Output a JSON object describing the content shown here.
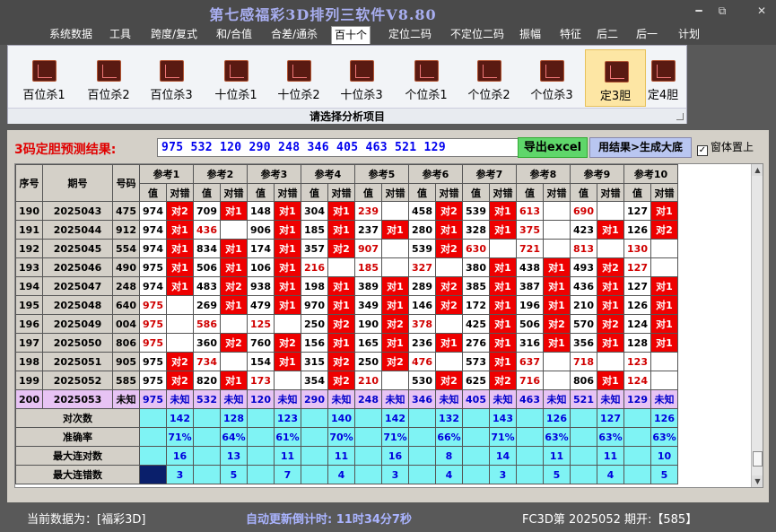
{
  "app": {
    "title": "第七感福彩3D排列三软件V8.80"
  },
  "window_buttons": {
    "minimize": "━",
    "restore": "⧉",
    "close": "✕"
  },
  "menu": [
    "系统数据",
    "工具",
    "跨度/复式",
    "和/合值",
    "合差/通杀",
    "百十个",
    "定位二码",
    "不定位二码",
    "振幅",
    "特征",
    "后二",
    "后一",
    "计划"
  ],
  "menu_active": "百十个",
  "ribbon": {
    "buttons": [
      "百位杀1",
      "百位杀2",
      "百位杀3",
      "十位杀1",
      "十位杀2",
      "十位杀3",
      "个位杀1",
      "个位杀2",
      "个位杀3",
      "定3胆",
      "定4胆"
    ],
    "active": "定3胆",
    "footer": "请选择分析项目"
  },
  "result": {
    "label": "3码定胆预测结果:",
    "value": "975 532 120 290 248 346 405 463 521 129",
    "export_button": "导出excel",
    "big_button": "用结果>生成大底",
    "on_top_label": "窗体置上",
    "on_top_checked": "✓"
  },
  "table": {
    "header": {
      "seq": "序号",
      "period": "期号",
      "code": "号码",
      "value": "值",
      "check": "对错"
    },
    "refs": [
      "参考1",
      "参考2",
      "参考3",
      "参考4",
      "参考5",
      "参考6",
      "参考7",
      "参考8",
      "参考9",
      "参考10"
    ],
    "rows": [
      {
        "seq": "190",
        "period": "2025043",
        "code": "475",
        "cells": [
          [
            "974",
            "对2"
          ],
          [
            "709",
            "对1"
          ],
          [
            "148",
            "对1"
          ],
          [
            "304",
            "对1"
          ],
          [
            "239",
            ""
          ],
          [
            "458",
            "对2"
          ],
          [
            "539",
            "对1"
          ],
          [
            "613",
            ""
          ],
          [
            "690",
            ""
          ],
          [
            "127",
            "对1"
          ]
        ]
      },
      {
        "seq": "191",
        "period": "2025044",
        "code": "912",
        "cells": [
          [
            "974",
            "对1"
          ],
          [
            "436",
            ""
          ],
          [
            "906",
            "对1"
          ],
          [
            "185",
            "对1"
          ],
          [
            "237",
            "对1"
          ],
          [
            "280",
            "对1"
          ],
          [
            "328",
            "对1"
          ],
          [
            "375",
            ""
          ],
          [
            "423",
            "对1"
          ],
          [
            "126",
            "对2"
          ]
        ]
      },
      {
        "seq": "192",
        "period": "2025045",
        "code": "554",
        "cells": [
          [
            "974",
            "对1"
          ],
          [
            "834",
            "对1"
          ],
          [
            "174",
            "对1"
          ],
          [
            "357",
            "对2"
          ],
          [
            "907",
            ""
          ],
          [
            "539",
            "对2"
          ],
          [
            "630",
            ""
          ],
          [
            "721",
            ""
          ],
          [
            "813",
            ""
          ],
          [
            "130",
            ""
          ]
        ]
      },
      {
        "seq": "193",
        "period": "2025046",
        "code": "490",
        "cells": [
          [
            "975",
            "对1"
          ],
          [
            "506",
            "对1"
          ],
          [
            "106",
            "对1"
          ],
          [
            "216",
            ""
          ],
          [
            "185",
            ""
          ],
          [
            "327",
            ""
          ],
          [
            "380",
            "对1"
          ],
          [
            "438",
            "对1"
          ],
          [
            "493",
            "对2"
          ],
          [
            "127",
            ""
          ]
        ]
      },
      {
        "seq": "194",
        "period": "2025047",
        "code": "248",
        "cells": [
          [
            "974",
            "对1"
          ],
          [
            "483",
            "对2"
          ],
          [
            "938",
            "对1"
          ],
          [
            "198",
            "对1"
          ],
          [
            "389",
            "对1"
          ],
          [
            "289",
            "对2"
          ],
          [
            "385",
            "对1"
          ],
          [
            "387",
            "对1"
          ],
          [
            "436",
            "对1"
          ],
          [
            "127",
            "对1"
          ]
        ]
      },
      {
        "seq": "195",
        "period": "2025048",
        "code": "640",
        "cells": [
          [
            "975",
            ""
          ],
          [
            "269",
            "对1"
          ],
          [
            "479",
            "对1"
          ],
          [
            "970",
            "对1"
          ],
          [
            "349",
            "对1"
          ],
          [
            "146",
            "对2"
          ],
          [
            "172",
            "对1"
          ],
          [
            "196",
            "对1"
          ],
          [
            "210",
            "对1"
          ],
          [
            "126",
            "对1"
          ]
        ]
      },
      {
        "seq": "196",
        "period": "2025049",
        "code": "004",
        "cells": [
          [
            "975",
            ""
          ],
          [
            "586",
            ""
          ],
          [
            "125",
            ""
          ],
          [
            "250",
            "对2"
          ],
          [
            "190",
            "对2"
          ],
          [
            "378",
            ""
          ],
          [
            "425",
            "对1"
          ],
          [
            "506",
            "对2"
          ],
          [
            "570",
            "对2"
          ],
          [
            "124",
            "对1"
          ]
        ]
      },
      {
        "seq": "197",
        "period": "2025050",
        "code": "806",
        "cells": [
          [
            "975",
            ""
          ],
          [
            "360",
            "对2"
          ],
          [
            "760",
            "对2"
          ],
          [
            "156",
            "对1"
          ],
          [
            "165",
            "对1"
          ],
          [
            "236",
            "对1"
          ],
          [
            "276",
            "对1"
          ],
          [
            "316",
            "对1"
          ],
          [
            "356",
            "对1"
          ],
          [
            "128",
            "对1"
          ]
        ]
      },
      {
        "seq": "198",
        "period": "2025051",
        "code": "905",
        "cells": [
          [
            "975",
            "对2"
          ],
          [
            "734",
            ""
          ],
          [
            "154",
            "对1"
          ],
          [
            "315",
            "对2"
          ],
          [
            "250",
            "对2"
          ],
          [
            "476",
            ""
          ],
          [
            "573",
            "对1"
          ],
          [
            "637",
            ""
          ],
          [
            "718",
            ""
          ],
          [
            "123",
            ""
          ]
        ]
      },
      {
        "seq": "199",
        "period": "2025052",
        "code": "585",
        "cells": [
          [
            "975",
            "对2"
          ],
          [
            "820",
            "对1"
          ],
          [
            "173",
            ""
          ],
          [
            "354",
            "对2"
          ],
          [
            "210",
            ""
          ],
          [
            "530",
            "对2"
          ],
          [
            "625",
            "对2"
          ],
          [
            "716",
            ""
          ],
          [
            "806",
            "对1"
          ],
          [
            "124",
            ""
          ]
        ]
      }
    ],
    "pending": {
      "seq": "200",
      "period": "2025053",
      "code": "未知",
      "cells": [
        [
          "975",
          "未知"
        ],
        [
          "532",
          "未知"
        ],
        [
          "120",
          "未知"
        ],
        [
          "290",
          "未知"
        ],
        [
          "248",
          "未知"
        ],
        [
          "346",
          "未知"
        ],
        [
          "405",
          "未知"
        ],
        [
          "463",
          "未知"
        ],
        [
          "521",
          "未知"
        ],
        [
          "129",
          "未知"
        ]
      ]
    },
    "stats": [
      {
        "label": "对次数",
        "values": [
          "142",
          "128",
          "123",
          "140",
          "142",
          "132",
          "143",
          "126",
          "127",
          "126"
        ]
      },
      {
        "label": "准确率",
        "values": [
          "71%",
          "64%",
          "61%",
          "70%",
          "71%",
          "66%",
          "71%",
          "63%",
          "63%",
          "63%"
        ]
      },
      {
        "label": "最大连对数",
        "values": [
          "16",
          "13",
          "11",
          "11",
          "16",
          "8",
          "14",
          "11",
          "11",
          "10"
        ]
      },
      {
        "label": "最大连错数",
        "values": [
          "3",
          "5",
          "7",
          "4",
          "3",
          "4",
          "3",
          "5",
          "4",
          "5"
        ]
      }
    ]
  },
  "scrollbar": {
    "up": "▲",
    "down": "▼"
  },
  "status": {
    "current_data": "当前数据为：[福彩3D]",
    "countdown": "自动更新倒计时:  11时34分7秒",
    "draw": "FC3D第 2025052 期开:【585】"
  },
  "colors": {
    "hit": "#ee0000",
    "pending_row": "#e7c3f4",
    "stats": "#7ff3f4",
    "prediction_text": "#0000ee",
    "label_red": "#e00000"
  }
}
